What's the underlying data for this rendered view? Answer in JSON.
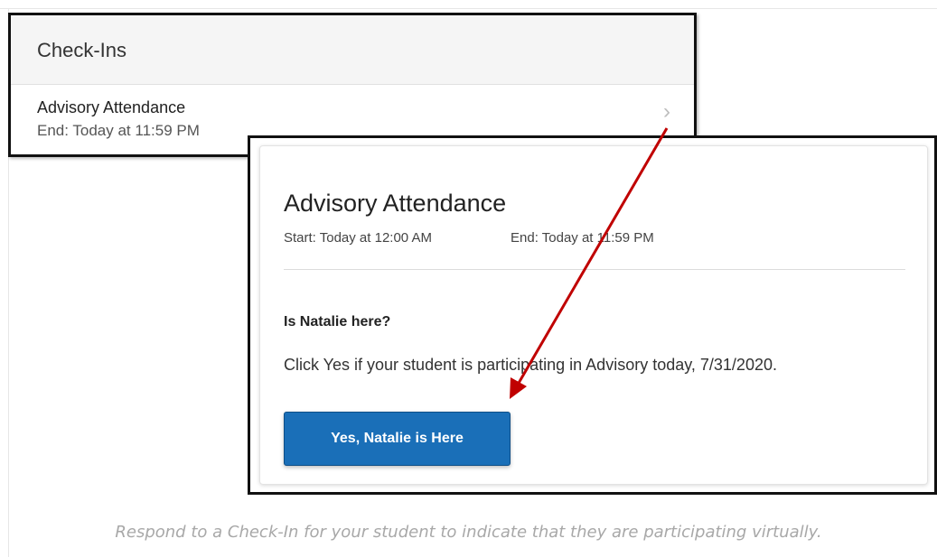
{
  "checkins": {
    "header": "Check-Ins",
    "item": {
      "title": "Advisory Attendance",
      "end": "End: Today at 11:59 PM"
    }
  },
  "detail": {
    "title": "Advisory Attendance",
    "start": "Start: Today at 12:00 AM",
    "end": "End: Today at 11:59 PM",
    "question": "Is Natalie here?",
    "instruction": "Click Yes if your student is participating in Advisory today, 7/31/2020.",
    "button_label": "Yes, Natalie is Here"
  },
  "caption": "Respond to a Check-In for your student to indicate that they are participating virtually.",
  "colors": {
    "button": "#1a6fb8",
    "arrow": "#c00000"
  },
  "icons": {
    "item_chevron": "chevron-right-icon"
  }
}
